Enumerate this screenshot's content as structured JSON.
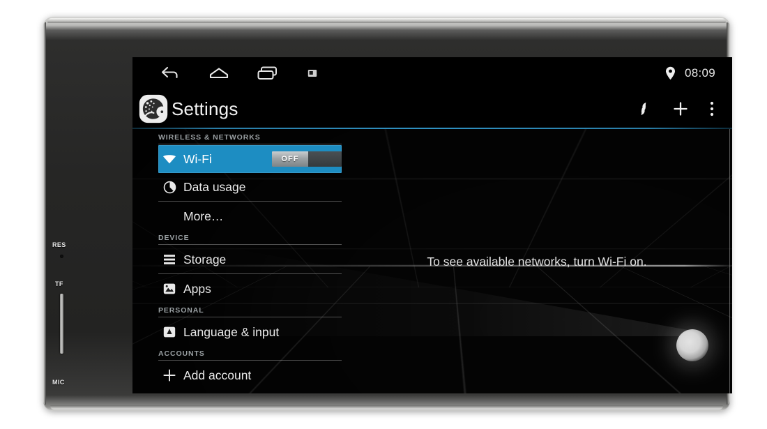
{
  "device": {
    "bezel_labels": {
      "reset": "RES",
      "tf_card": "TF",
      "microphone": "MIC"
    }
  },
  "status_bar": {
    "nav_back_icon": "back-arrow-icon",
    "nav_home_icon": "home-icon",
    "nav_recents_icon": "recents-icon",
    "nav_screenshot_icon": "screenshot-icon",
    "location_icon": "location-pin-icon",
    "time": "08:09"
  },
  "action_bar": {
    "app_icon": "settings-gear-icon",
    "title": "Settings",
    "sync_icon": "sync-icon",
    "add_icon": "plus-icon",
    "overflow_icon": "overflow-menu-icon",
    "divider_color": "#2f91c2"
  },
  "settings": {
    "sections": [
      {
        "header": "WIRELESS & NETWORKS",
        "rows": [
          {
            "label": "Wi-Fi",
            "icon": "wifi-icon",
            "selected": true,
            "toggle": {
              "state": "OFF",
              "on": false
            }
          },
          {
            "label": "Data usage",
            "icon": "data-usage-pie-icon",
            "selected": false
          },
          {
            "label": "More…",
            "icon": "none",
            "selected": false,
            "indent": true
          }
        ]
      },
      {
        "header": "DEVICE",
        "rows": [
          {
            "label": "Storage",
            "icon": "storage-icon",
            "selected": false
          },
          {
            "label": "Apps",
            "icon": "apps-icon",
            "selected": false
          }
        ]
      },
      {
        "header": "PERSONAL",
        "rows": [
          {
            "label": "Language & input",
            "icon": "language-input-icon",
            "selected": false
          }
        ]
      },
      {
        "header": "ACCOUNTS",
        "rows": [
          {
            "label": "Add account",
            "icon": "plus-icon",
            "selected": false
          }
        ]
      }
    ]
  },
  "detail_pane": {
    "empty_message": "To see available networks, turn Wi-Fi on."
  },
  "colors": {
    "accent_blue": "#1d8dc2",
    "divider_blue": "#2f91c2",
    "screen_background": "#050505",
    "text_primary": "#e9e9e9",
    "text_section_header": "#9aa0a3"
  }
}
